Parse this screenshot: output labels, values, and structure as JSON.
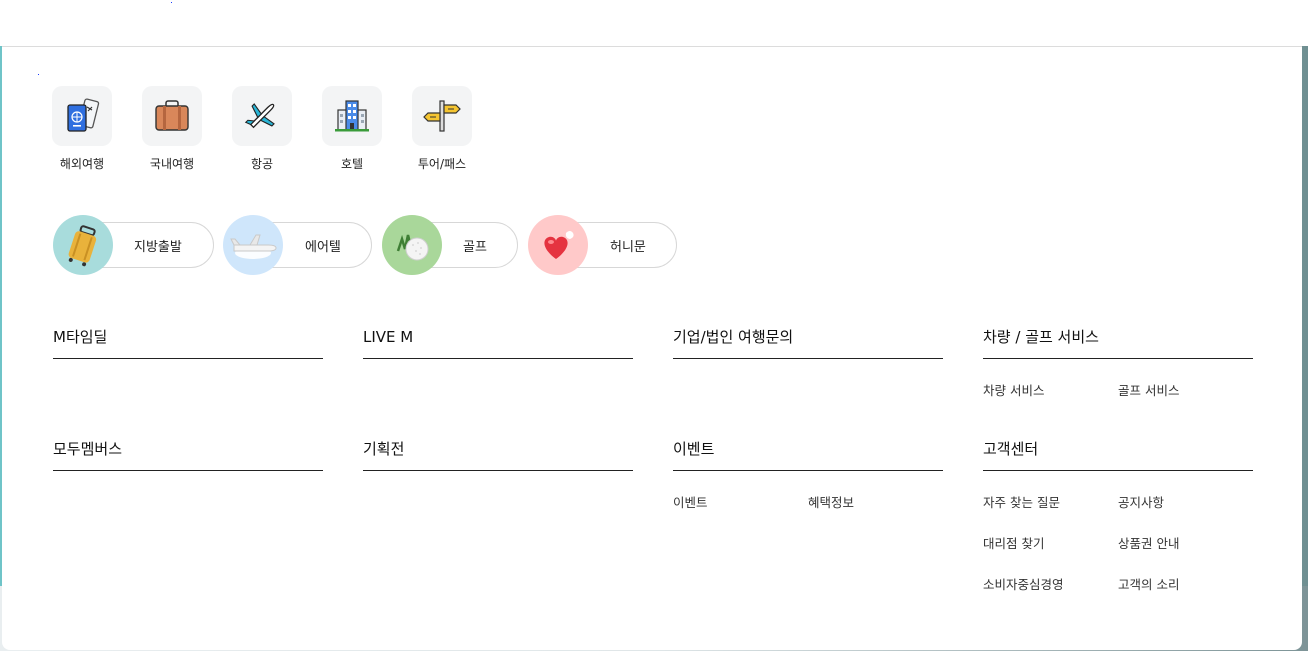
{
  "categories": [
    {
      "label": "해외여행",
      "icon": "passport-icon"
    },
    {
      "label": "국내여행",
      "icon": "suitcase-icon"
    },
    {
      "label": "항공",
      "icon": "airplane-icon"
    },
    {
      "label": "호텔",
      "icon": "hotel-building-icon"
    },
    {
      "label": "투어/패스",
      "icon": "signpost-icon"
    }
  ],
  "themes": [
    {
      "label": "지방출발",
      "image": "yellow-suitcase-image",
      "bg": "#a8dcdc"
    },
    {
      "label": "에어텔",
      "image": "airplane-cloud-image",
      "bg": "#cfe6fb"
    },
    {
      "label": "골프",
      "image": "golf-ball-image",
      "bg": "#a9d79a"
    },
    {
      "label": "허니문",
      "image": "heart-image",
      "bg": "#ffc9c9"
    }
  ],
  "sections": {
    "mtime": {
      "title": "M타임딜"
    },
    "live": {
      "title": "LIVE M"
    },
    "corporate": {
      "title": "기업/법인 여행문의"
    },
    "car_golf": {
      "title": "차량 / 골프 서비스",
      "links": [
        "차량 서비스",
        "골프 서비스"
      ]
    },
    "members": {
      "title": "모두멤버스"
    },
    "exhibition": {
      "title": "기획전"
    },
    "event": {
      "title": "이벤트",
      "links": [
        "이벤트",
        "혜택정보"
      ]
    },
    "support": {
      "title": "고객센터",
      "links": [
        "자주 찾는 질문",
        "공지사항",
        "대리점 찾기",
        "상품권 안내",
        "소비자중심경영",
        "고객의 소리"
      ]
    }
  }
}
